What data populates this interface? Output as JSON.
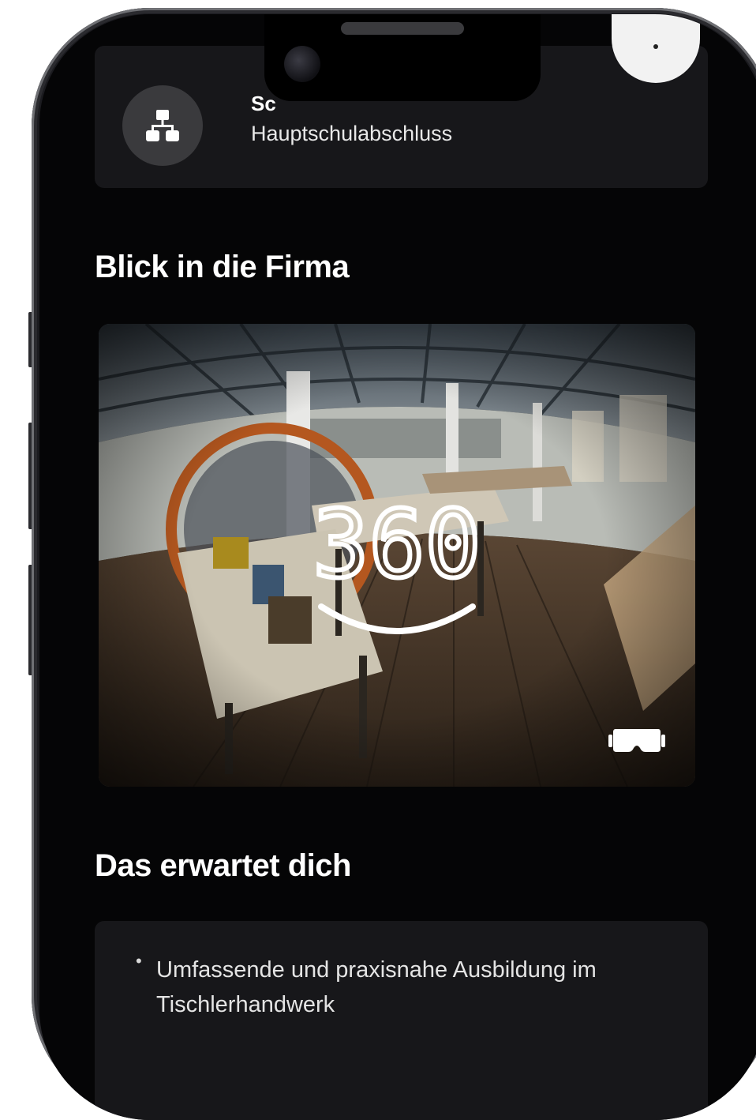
{
  "info_card": {
    "label": "Sc",
    "value": "Hauptschulabschluss",
    "icon": "org-chart-icon"
  },
  "section_company": {
    "title": "Blick in die Firma"
  },
  "media": {
    "badge_text": "360",
    "vr_icon": "vr-headset-icon"
  },
  "section_expect": {
    "title": "Das erwartet dich",
    "items": [
      "Umfassende und praxisnahe Ausbildung im Tischlerhandwerk"
    ],
    "bullet": "•"
  },
  "colors": {
    "background": "#050506",
    "card": "#17171a",
    "text": "#ffffff"
  }
}
